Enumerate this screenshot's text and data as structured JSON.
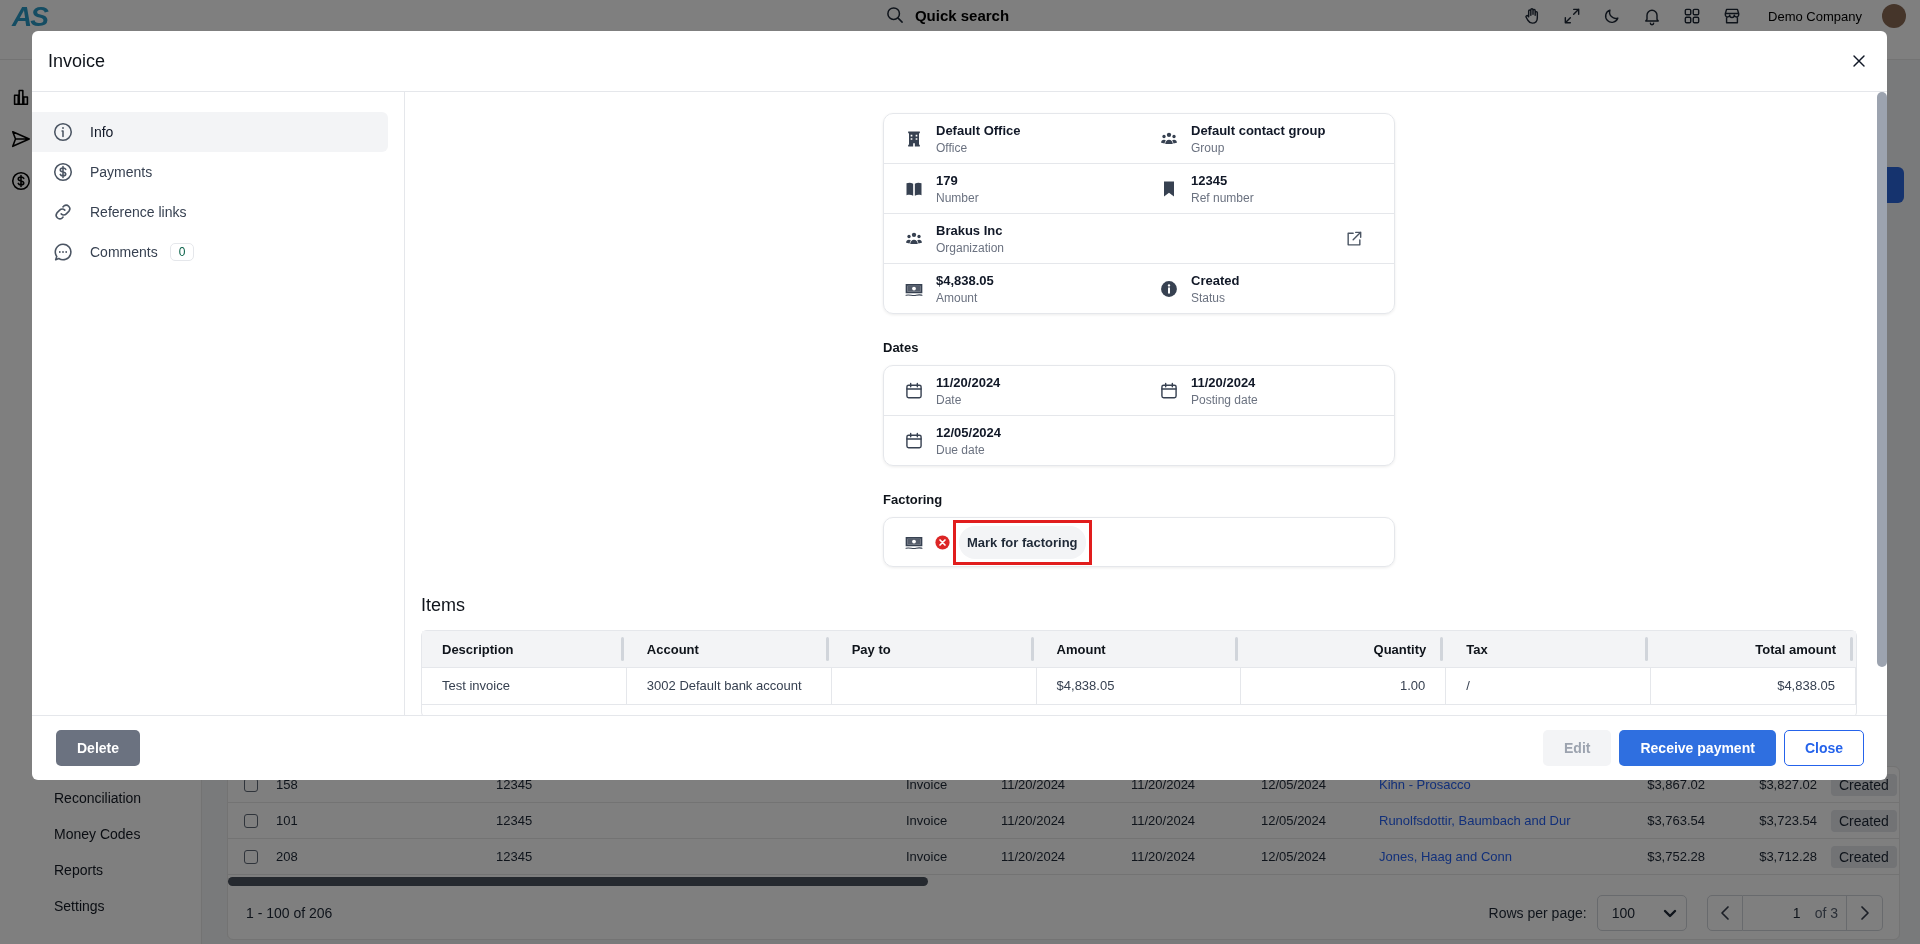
{
  "topbar": {
    "logo": "AS",
    "search": {
      "placeholder": "Quick search"
    },
    "company": "Demo Company"
  },
  "nav": {
    "items": [
      {
        "label": "Reconciliation"
      },
      {
        "label": "Money Codes"
      },
      {
        "label": "Reports"
      },
      {
        "label": "Settings"
      }
    ]
  },
  "invoices": {
    "rows": [
      {
        "checked": false,
        "number": "158",
        "ref_number": "12345",
        "type": "Invoice",
        "date": "11/20/2024",
        "posting_date": "11/20/2024",
        "due_date": "12/05/2024",
        "customer": "Kihn - Prosacco",
        "amount": "$3,867.02",
        "balance": "$3,827.02",
        "status": "Created"
      },
      {
        "checked": false,
        "number": "101",
        "ref_number": "12345",
        "type": "Invoice",
        "date": "11/20/2024",
        "posting_date": "11/20/2024",
        "due_date": "12/05/2024",
        "customer": "Runolfsdottir, Baumbach and Dur",
        "amount": "$3,763.54",
        "balance": "$3,723.54",
        "status": "Created"
      },
      {
        "checked": false,
        "number": "208",
        "ref_number": "12345",
        "type": "Invoice",
        "date": "11/20/2024",
        "posting_date": "11/20/2024",
        "due_date": "12/05/2024",
        "customer": "Jones, Haag and Conn",
        "amount": "$3,752.28",
        "balance": "$3,712.28",
        "status": "Created"
      }
    ],
    "range": "1 - 100 of 206",
    "rows_per_page_label": "Rows per page:",
    "rows_per_page": "100",
    "page": "1",
    "page_count": "of 3"
  },
  "modal": {
    "title": "Invoice",
    "tabs": [
      {
        "label": "Info",
        "selected": true
      },
      {
        "label": "Payments",
        "selected": false
      },
      {
        "label": "Reference links",
        "selected": false
      },
      {
        "label": "Comments",
        "selected": false,
        "count": "0"
      }
    ],
    "details": {
      "rows": [
        {
          "external_link": false,
          "cells": [
            {
              "value": "Default Office",
              "label": "Office"
            },
            {
              "value": "Default contact group",
              "label": "Group"
            }
          ]
        },
        {
          "external_link": false,
          "cells": [
            {
              "value": "179",
              "label": "Number"
            },
            {
              "value": "12345",
              "label": "Ref number"
            }
          ]
        },
        {
          "external_link": true,
          "cells": [
            {
              "value": "Brakus Inc",
              "label": "Organization"
            }
          ]
        },
        {
          "external_link": false,
          "cells": [
            {
              "value": "$4,838.05",
              "label": "Amount"
            },
            {
              "value": "Created",
              "label": "Status"
            }
          ]
        }
      ]
    },
    "dates": {
      "title": "Dates",
      "rows": [
        {
          "cells": [
            {
              "value": "11/20/2024",
              "label": "Date"
            },
            {
              "value": "11/20/2024",
              "label": "Posting date"
            }
          ]
        },
        {
          "cells": [
            {
              "value": "12/05/2024",
              "label": "Due date"
            }
          ]
        }
      ]
    },
    "factoring": {
      "title": "Factoring",
      "marked": false,
      "action": "Mark for factoring",
      "highlighted": true
    },
    "items": {
      "title": "Items",
      "columns": [
        "Description",
        "Account",
        "Pay to",
        "Amount",
        "Quantity",
        "Tax",
        "Total amount"
      ],
      "rows": [
        [
          "Test invoice",
          "3002 Default bank account",
          null,
          "$4,838.05",
          "1.00",
          "/",
          "$4,838.05"
        ]
      ]
    },
    "actions": {
      "left": [
        {
          "label": "Delete",
          "kind": "secondary",
          "disabled": false
        }
      ],
      "right": [
        {
          "label": "Edit",
          "kind": "plain",
          "disabled": true
        },
        {
          "label": "Receive payment",
          "kind": "primary",
          "disabled": false
        },
        {
          "label": "Close",
          "kind": "outline",
          "disabled": false
        }
      ]
    }
  }
}
